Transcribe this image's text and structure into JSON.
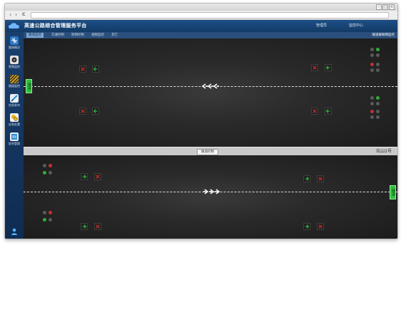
{
  "browser": {
    "back_glyph": "‹",
    "forward_glyph": "›",
    "reload_glyph": "C"
  },
  "header": {
    "title": "高速公路综合管理服务平台",
    "link_manage": "管理员",
    "link_center": "监控中心"
  },
  "subnav": {
    "tabs": [
      {
        "label": "隧道监控"
      },
      {
        "label": "交通控制"
      },
      {
        "label": "照明控制"
      },
      {
        "label": "视频监控"
      },
      {
        "label": "其它"
      }
    ],
    "right_note": "隧道群联网监控"
  },
  "sidebar": {
    "items": [
      {
        "label": "路网概况",
        "icon": "network-icon",
        "color": "#2a78c6"
      },
      {
        "label": "视频监控",
        "icon": "camera-icon",
        "color": "#3a3a3a"
      },
      {
        "label": "隧道监控",
        "icon": "tunnel-icon",
        "color": "#d4a21c"
      },
      {
        "label": "信息发布",
        "icon": "publish-icon",
        "color": "#2c8fd8"
      },
      {
        "label": "应急处置",
        "icon": "emergency-icon",
        "color": "#e8b21e"
      },
      {
        "label": "综合管理",
        "icon": "settings-icon",
        "color": "#2c8fd8"
      }
    ]
  },
  "tunnel": {
    "upper_entrance_sign": "隧道",
    "lower_exit_sign": "隧道",
    "control_button": "隧道控制",
    "section_name": "坑山1号"
  },
  "colors": {
    "green_signal": "#2fae3a",
    "red_signal": "#c53030",
    "header_blue": "#1d4f86"
  }
}
